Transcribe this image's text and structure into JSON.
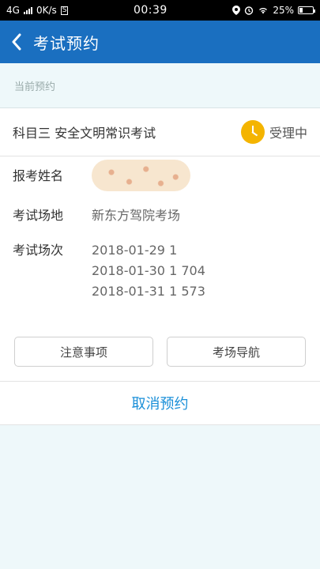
{
  "status_bar": {
    "network": "4G",
    "speed": "0K/s",
    "speed_badge": "S",
    "time": "00:39",
    "battery": "25%"
  },
  "header": {
    "title": "考试预约",
    "back_icon": "chevron-left-icon"
  },
  "section": {
    "current_label": "当前预约"
  },
  "appointment": {
    "subject": "科目三 安全文明常识考试",
    "status": "受理中",
    "status_icon": "clock-icon",
    "status_color": "#f4b400",
    "fields": {
      "name_label": "报考姓名",
      "venue_label": "考试场地",
      "venue_value": "新东方驾院考场",
      "session_label": "考试场次"
    },
    "sessions": [
      "2018-01-29 1",
      "2018-01-30 1 704",
      "2018-01-31 1 573"
    ]
  },
  "actions": {
    "notes_label": "注意事项",
    "nav_label": "考场导航",
    "cancel_label": "取消预约"
  },
  "colors": {
    "header_bg": "#1a6fc0",
    "link": "#1a8fd8",
    "page_bg": "#eef8fa"
  }
}
